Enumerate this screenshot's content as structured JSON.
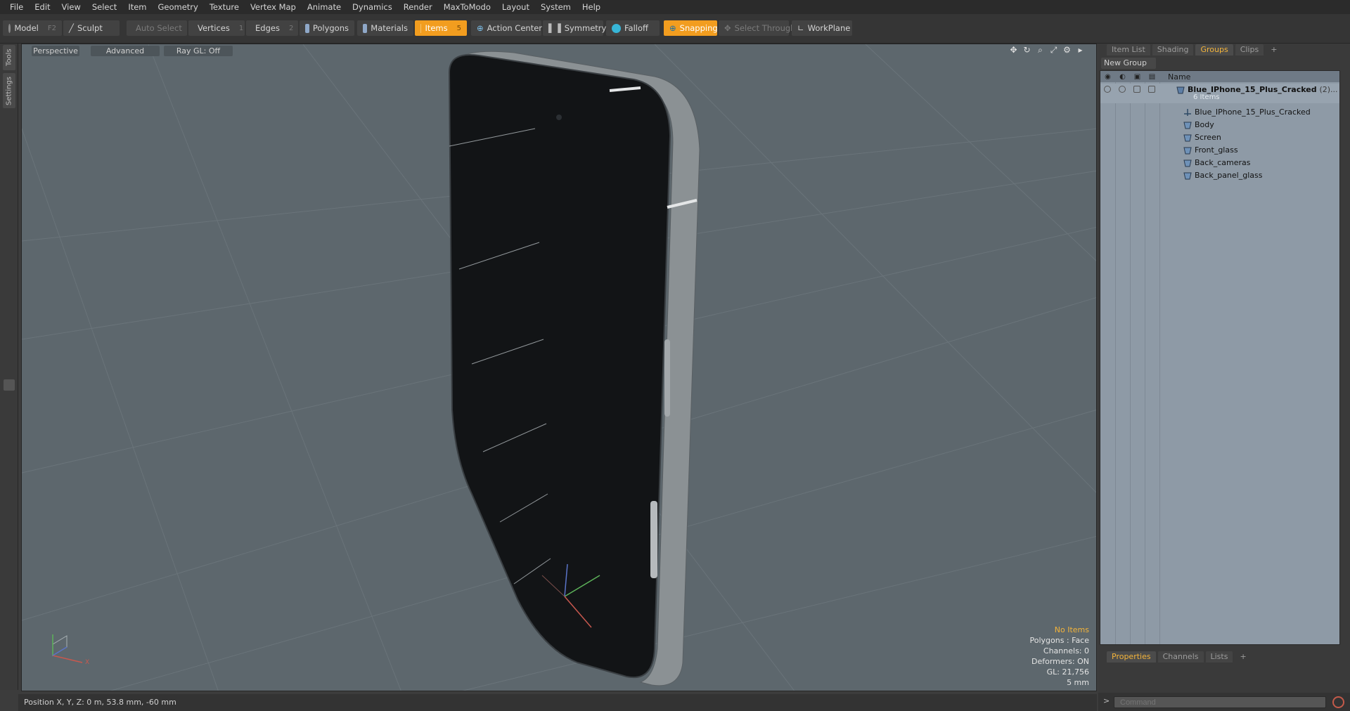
{
  "menu": [
    "File",
    "Edit",
    "View",
    "Select",
    "Item",
    "Geometry",
    "Texture",
    "Vertex Map",
    "Animate",
    "Dynamics",
    "Render",
    "MaxToModo",
    "Layout",
    "System",
    "Help"
  ],
  "toolbar": {
    "model": "Model",
    "model_key": "F2",
    "sculpt": "Sculpt",
    "auto_select": "Auto Select",
    "vertices": "Vertices",
    "vertices_key": "1",
    "edges": "Edges",
    "edges_key": "2",
    "polygons": "Polygons",
    "materials": "Materials",
    "items": "Items",
    "items_key": "5",
    "action_center": "Action Center",
    "symmetry": "Symmetry",
    "falloff": "Falloff",
    "snapping": "Snapping",
    "select_through": "Select Through",
    "workplane": "WorkPlane"
  },
  "left_tabs": [
    "Tools",
    "Settings"
  ],
  "viewport": {
    "tabs": [
      "Perspective",
      "Advanced",
      "Ray GL: Off"
    ],
    "info": {
      "selection": "No Items",
      "polygons": "Polygons : Face",
      "channels": "Channels: 0",
      "deformers": "Deformers: ON",
      "gl": "GL: 21,756",
      "scale": "5 mm"
    }
  },
  "status": "Position X, Y, Z:   0 m, 53.8 mm, -60 mm",
  "panel": {
    "tabs": [
      "Item List",
      "Shading",
      "Groups",
      "Clips",
      "+"
    ],
    "active_tab": "Groups",
    "new_group": "New Group",
    "column_name": "Name",
    "group": {
      "name": "Blue_IPhone_15_Plus_Cracked",
      "count": "(2)...",
      "subtitle": "6 Items"
    },
    "items": [
      "Blue_IPhone_15_Plus_Cracked",
      "Body",
      "Screen",
      "Front_glass",
      "Back_cameras",
      "Back_panel_glass"
    ],
    "bottom_tabs": [
      "Properties",
      "Channels",
      "Lists",
      "+"
    ],
    "command_placeholder": "Command"
  },
  "colors": {
    "accent": "#f29d1f",
    "viewport_bg": "#5d676d",
    "tree_bg": "#8e9aa6"
  }
}
